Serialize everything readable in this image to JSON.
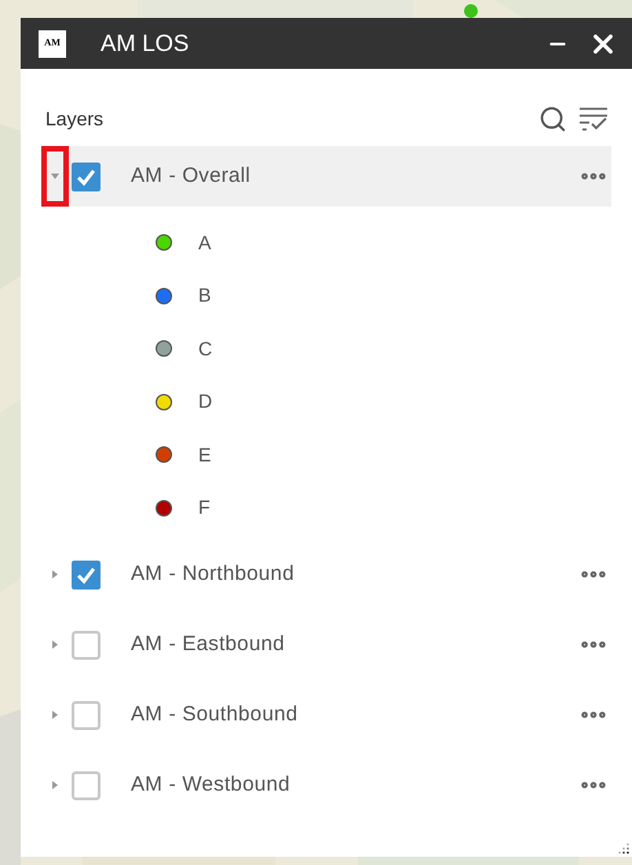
{
  "window": {
    "title": "AM LOS",
    "logo": "AM"
  },
  "panel": {
    "label": "Layers"
  },
  "layers": [
    {
      "label": "AM - Overall",
      "expanded": true,
      "checked": true,
      "highlighted": true,
      "legend": [
        {
          "label": "A",
          "color": "#4cd600"
        },
        {
          "label": "B",
          "color": "#1e6ef5"
        },
        {
          "label": "C",
          "color": "#8fa39c"
        },
        {
          "label": "D",
          "color": "#f2dc00"
        },
        {
          "label": "E",
          "color": "#d13f00"
        },
        {
          "label": "F",
          "color": "#b30000"
        }
      ]
    },
    {
      "label": "AM - Northbound",
      "expanded": false,
      "checked": true,
      "highlighted": false
    },
    {
      "label": "AM - Eastbound",
      "expanded": false,
      "checked": false,
      "highlighted": false
    },
    {
      "label": "AM - Southbound",
      "expanded": false,
      "checked": false,
      "highlighted": false
    },
    {
      "label": "AM - Westbound",
      "expanded": false,
      "checked": false,
      "highlighted": false
    }
  ]
}
